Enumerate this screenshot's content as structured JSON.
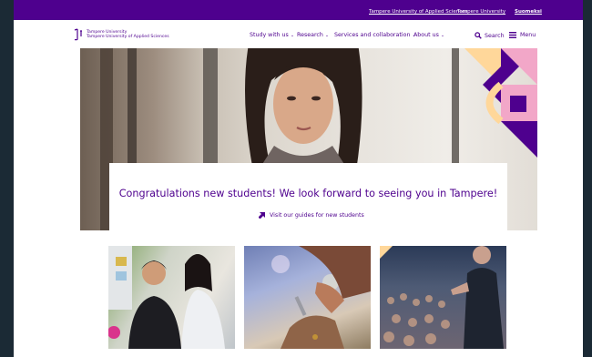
{
  "topbar": {
    "links": [
      "Tampere University of Applied Sciences",
      "Tampere University",
      "Suomeksi"
    ]
  },
  "header": {
    "logo": {
      "line1": "Tampere University",
      "line2": "Tampere University of Applied Sciences"
    },
    "nav": [
      "Study with us",
      "Research",
      "Services and collaboration",
      "About us"
    ],
    "search_label": "Search",
    "menu_label": "Menu"
  },
  "hero": {
    "title": "Congratulations new students! We look forward to seeing you in Tampere!",
    "link_label": "Visit our guides for new students"
  },
  "colors": {
    "brand": "#4e008e",
    "accent_pink": "#f2a7c8",
    "accent_yellow": "#ffd79a"
  }
}
